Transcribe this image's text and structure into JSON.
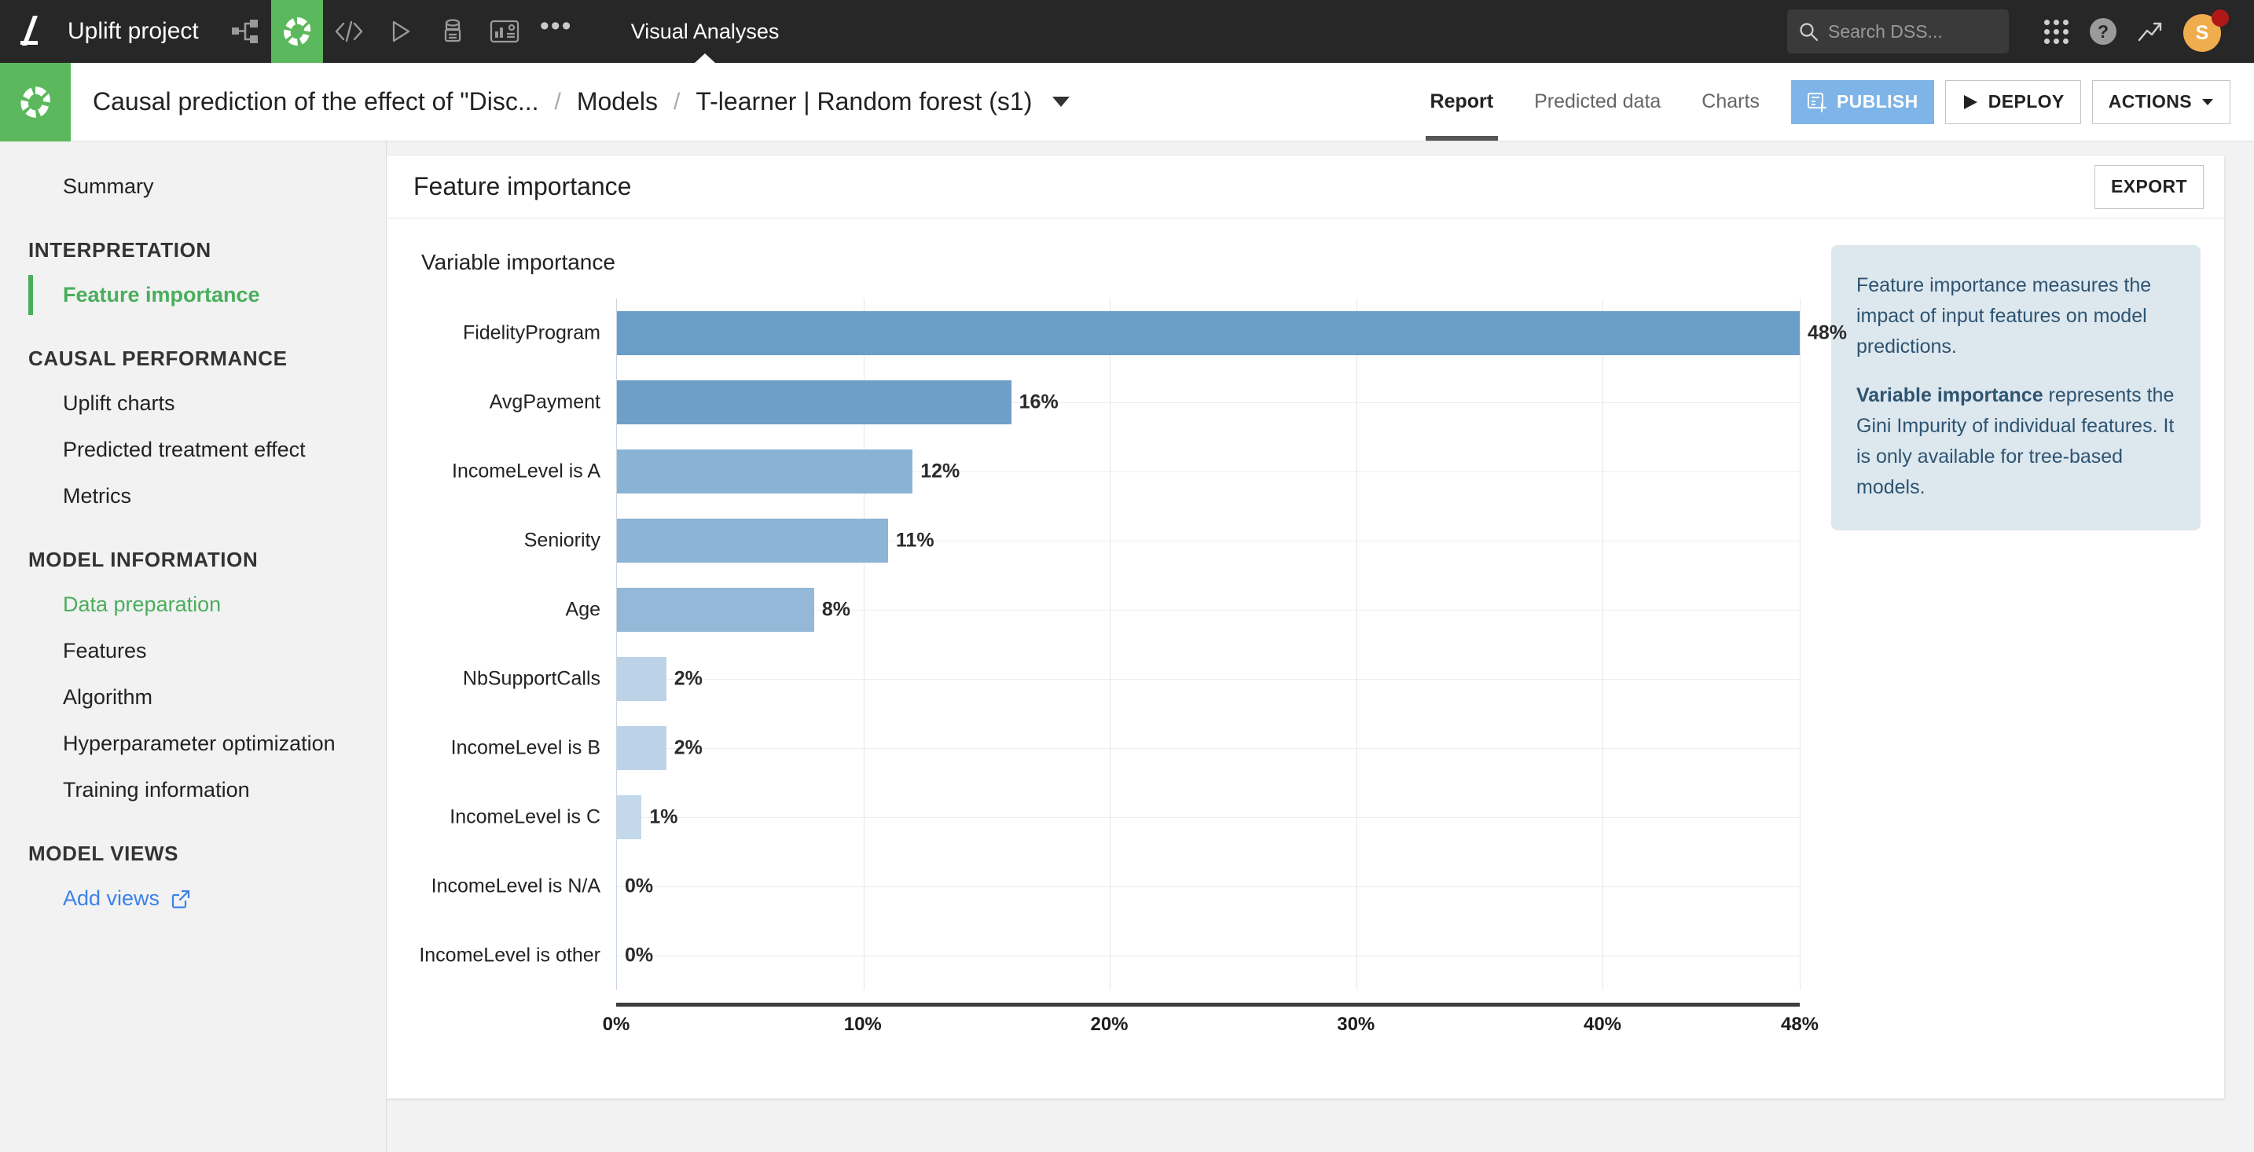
{
  "topbar": {
    "project_name": "Uplift project",
    "tools": [
      {
        "name": "flow-icon",
        "label": "Flow"
      },
      {
        "name": "lab-icon",
        "label": "Lab"
      },
      {
        "name": "code-icon",
        "label": "Code"
      },
      {
        "name": "scenario-icon",
        "label": "Scenarios"
      },
      {
        "name": "jobs-icon",
        "label": "Jobs"
      },
      {
        "name": "dashboard-icon",
        "label": "Dashboards"
      },
      {
        "name": "more-icon",
        "label": "More"
      }
    ],
    "active_tab": "Visual Analyses",
    "search_placeholder": "Search DSS...",
    "avatar_initial": "S"
  },
  "header": {
    "breadcrumb": [
      "Causal prediction of the effect of \"Disc...",
      "Models",
      "T-learner | Random forest (s1)"
    ],
    "separator": "/",
    "tabs": [
      {
        "label": "Report",
        "active": true
      },
      {
        "label": "Predicted data",
        "active": false
      },
      {
        "label": "Charts",
        "active": false
      }
    ],
    "publish_label": "PUBLISH",
    "deploy_label": "DEPLOY",
    "actions_label": "ACTIONS"
  },
  "sidebar": {
    "top_link": "Summary",
    "sections": [
      {
        "title": "INTERPRETATION",
        "items": [
          {
            "label": "Feature importance",
            "state": "active"
          }
        ]
      },
      {
        "title": "CAUSAL PERFORMANCE",
        "items": [
          {
            "label": "Uplift charts",
            "state": "normal"
          },
          {
            "label": "Predicted treatment effect",
            "state": "normal"
          },
          {
            "label": "Metrics",
            "state": "normal"
          }
        ]
      },
      {
        "title": "MODEL INFORMATION",
        "items": [
          {
            "label": "Data preparation",
            "state": "green"
          },
          {
            "label": "Features",
            "state": "normal"
          },
          {
            "label": "Algorithm",
            "state": "normal"
          },
          {
            "label": "Hyperparameter optimization",
            "state": "normal"
          },
          {
            "label": "Training information",
            "state": "normal"
          }
        ]
      },
      {
        "title": "MODEL VIEWS",
        "items": [
          {
            "label": "Add views",
            "state": "link"
          }
        ]
      }
    ]
  },
  "panel": {
    "title": "Feature importance",
    "export_label": "EXPORT"
  },
  "info": {
    "paragraph1": "Feature importance measures the impact of input features on model predictions.",
    "lead": "Variable importance",
    "paragraph2_rest": " represents the Gini Impurity of individual features. It is only available for tree-based models."
  },
  "chart_data": {
    "type": "bar",
    "orientation": "horizontal",
    "title": "Variable importance",
    "xlabel": "",
    "ylabel": "",
    "xlim": [
      0,
      48
    ],
    "grid": true,
    "legend": "none",
    "tick_labels": [
      "0%",
      "10%",
      "20%",
      "30%",
      "40%",
      "48%"
    ],
    "ticks": [
      0,
      10,
      20,
      30,
      40,
      48
    ],
    "categories": [
      "FidelityProgram",
      "AvgPayment",
      "IncomeLevel is A",
      "Seniority",
      "Age",
      "NbSupportCalls",
      "IncomeLevel is B",
      "IncomeLevel is C",
      "IncomeLevel is N/A",
      "IncomeLevel is other"
    ],
    "values": [
      48,
      16,
      12,
      11,
      8,
      2,
      2,
      1,
      0,
      0
    ],
    "data_labels": [
      "48%",
      "16%",
      "12%",
      "11%",
      "8%",
      "2%",
      "2%",
      "1%",
      "0%",
      "0%"
    ],
    "bar_colors": [
      "#6a9dc8",
      "#6f9fc9",
      "#8ab2d5",
      "#8db4d6",
      "#93b8d8",
      "#bcd3e7",
      "#bcd3e7",
      "#c3d8ea",
      "#c3d8ea",
      "#c3d8ea"
    ]
  }
}
